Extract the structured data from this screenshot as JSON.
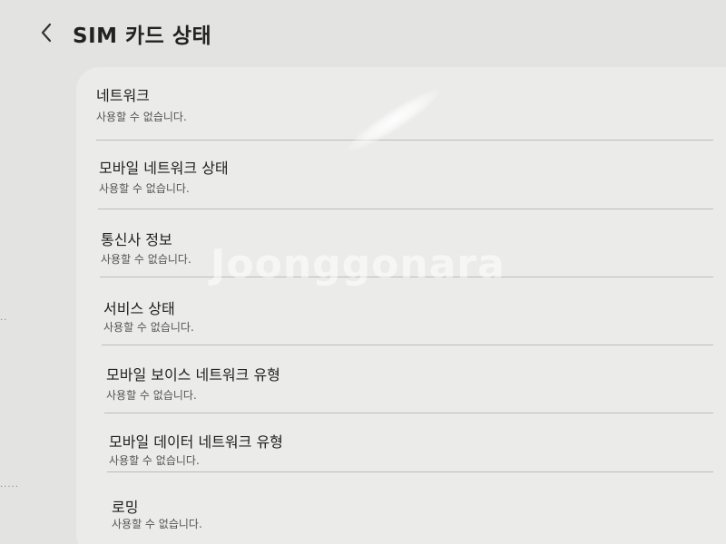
{
  "header": {
    "back_icon": "chevron-left-icon",
    "title": "SIM 카드 상태"
  },
  "items": [
    {
      "title": "네트워크",
      "subtitle": "사용할 수 없습니다."
    },
    {
      "title": "모바일 네트워크 상태",
      "subtitle": "사용할 수 없습니다."
    },
    {
      "title": "통신사 정보",
      "subtitle": "사용할 수 없습니다."
    },
    {
      "title": "서비스 상태",
      "subtitle": "사용할 수 없습니다."
    },
    {
      "title": "모바일 보이스 네트워크 유형",
      "subtitle": "사용할 수 없습니다."
    },
    {
      "title": "모바일 데이터 네트워크 유형",
      "subtitle": "사용할 수 없습니다."
    },
    {
      "title": "로밍",
      "subtitle": "사용할 수 없습니다."
    }
  ],
  "watermark": {
    "text": "Joonggonara"
  },
  "colors": {
    "background": "#e3e3e1",
    "card": "#ebebea",
    "divider": "#bdbdbb"
  }
}
